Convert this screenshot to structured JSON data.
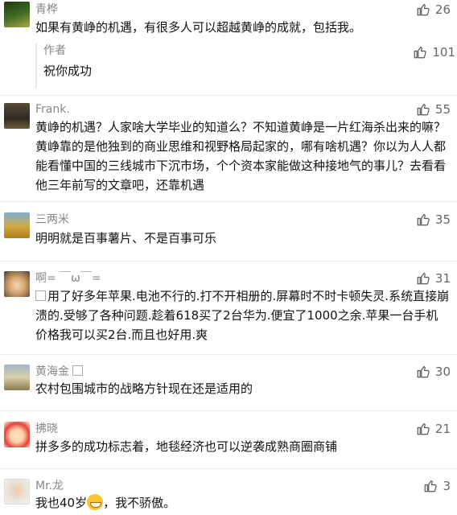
{
  "comments": [
    {
      "name": "青桦",
      "likes": "26",
      "text": "如果有黄峥的机遇，有很多人可以超越黄峥的成就，包括我。",
      "reply": {
        "name": "作者",
        "likes": "101",
        "text": "祝你成功"
      }
    },
    {
      "name": "Frank.",
      "likes": "55",
      "text": "黄峥的机遇？人家啥大学毕业的知道么？不知道黄峥是一片红海杀出来的嘛？黄峥靠的是他独到的商业思维和视野格局起家的，哪有啥机遇？你以为人人都能看懂中国的三线城市下沉市场，个个资本家能做这种接地气的事儿？去看看他三年前写的文章吧，还靠机遇"
    },
    {
      "name": "三两米",
      "likes": "35",
      "text": "明明就是百事薯片、不是百事可乐"
    },
    {
      "name": "啊= ￣ω￣=",
      "likes": "31",
      "text": "用了好多年苹果.电池不行的.打不开相册的.屏幕时不时卡顿失灵.系统直接崩溃的.受够了各种问题.趁着618买了2台华为.便宜了1000之余.苹果一台手机价格我可以买2台.而且也好用.爽"
    },
    {
      "name": "黄海金",
      "likes": "30",
      "text": "农村包围城市的战略方针现在还是适用的"
    },
    {
      "name": "拂晓",
      "likes": "21",
      "text": "拼多多的成功标志着，地毯经济也可以逆袭成熟商圈商铺"
    },
    {
      "name": "Mr.龙",
      "likes": "3",
      "text_before": "我也40岁",
      "emoji": "grinning-face",
      "text_after": "，我不骄傲。"
    }
  ],
  "icons": {
    "like": "thumbs-up-icon"
  },
  "colors": {
    "name": "#888888",
    "text": "#111111",
    "likes": "#666666"
  }
}
